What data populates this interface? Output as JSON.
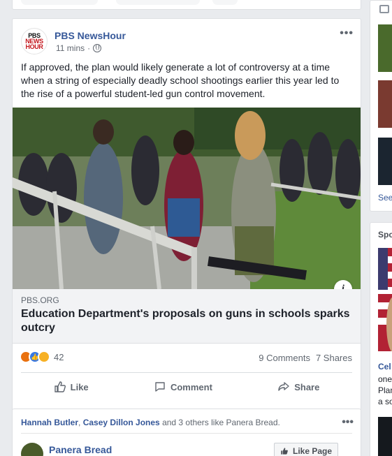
{
  "post": {
    "page_name": "PBS NewsHour",
    "logo": {
      "line1": "PBS",
      "line2": "NEWS",
      "line3": "HOUR"
    },
    "time": "11 mins",
    "text": "If approved, the plan would likely generate a lot of controversy at a time when a string of especially deadly school shootings earlier this year led to the rise of a powerful student-led gun control movement.",
    "link": {
      "domain": "PBS.ORG",
      "headline": "Education Department's proposals on guns in schools sparks outcry"
    },
    "reaction_count": "42",
    "comments": "9 Comments",
    "shares": "7 Shares",
    "actions": {
      "like": "Like",
      "comment": "Comment",
      "share": "Share"
    }
  },
  "suggested": {
    "friend1": "Hannah Butler",
    "separator": ", ",
    "friend2": "Casey Dillon Jones",
    "rest": " and 3 others like Panera Bread.",
    "page_name": "Panera Bread",
    "like_page": "Like Page"
  },
  "right_column": {
    "see": "See",
    "sponsored": "Spo",
    "celeb": "Cel",
    "lines": [
      "one",
      "Plan",
      "a so"
    ]
  },
  "colors": {
    "link": "#365899",
    "background": "#e9ebee",
    "card": "#ffffff"
  }
}
